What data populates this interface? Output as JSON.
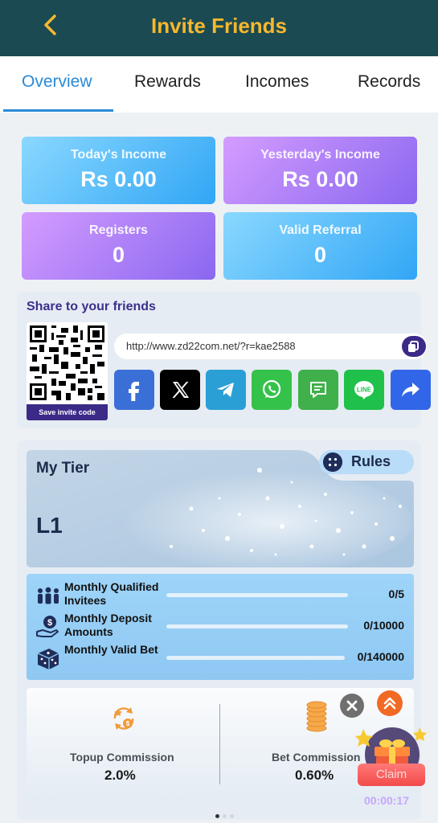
{
  "header": {
    "title": "Invite Friends",
    "back_icon": "chevron-left-icon"
  },
  "tabs": [
    {
      "label": "Overview",
      "active": true
    },
    {
      "label": "Rewards",
      "active": false
    },
    {
      "label": "Incomes",
      "active": false
    },
    {
      "label": "Records",
      "active": false
    }
  ],
  "stats": {
    "today_income": {
      "label": "Today's Income",
      "value": "Rs 0.00"
    },
    "yesterday_income": {
      "label": "Yesterday's Income",
      "value": "Rs 0.00"
    },
    "registers": {
      "label": "Registers",
      "value": "0"
    },
    "valid_referral": {
      "label": "Valid Referral",
      "value": "0"
    }
  },
  "share": {
    "title": "Share to your friends",
    "save_code_label": "Save invite code",
    "invite_link": "http://www.zd22com.net/?r=kae2588",
    "buttons": [
      {
        "name": "facebook",
        "color": "#3b6fd8"
      },
      {
        "name": "x",
        "color": "#000000"
      },
      {
        "name": "telegram",
        "color": "#2a9fd6"
      },
      {
        "name": "whatsapp",
        "color": "#35c24a"
      },
      {
        "name": "sms",
        "color": "#3fb04a"
      },
      {
        "name": "line",
        "color": "#1fc14b"
      },
      {
        "name": "more-share",
        "color": "#3266e8"
      }
    ]
  },
  "tier": {
    "title": "My Tier",
    "level": "L1",
    "rules_label": "Rules",
    "progress": [
      {
        "label": "Monthly Qualified Invitees",
        "value": "0/5"
      },
      {
        "label": "Monthly Deposit Amounts",
        "value": "0/10000"
      },
      {
        "label": "Monthly Valid Bet",
        "value": "0/140000"
      }
    ],
    "commissions": [
      {
        "label": "Topup Commission",
        "value": "2.0%"
      },
      {
        "label": "Bet Commission",
        "value": "0.60%"
      }
    ]
  },
  "floating": {
    "claim_label": "Claim",
    "timer": "00:00:17"
  },
  "colors": {
    "header_bg": "#1c4a52",
    "title_color": "#f5b82e",
    "active_tab": "#2a8ad6"
  }
}
